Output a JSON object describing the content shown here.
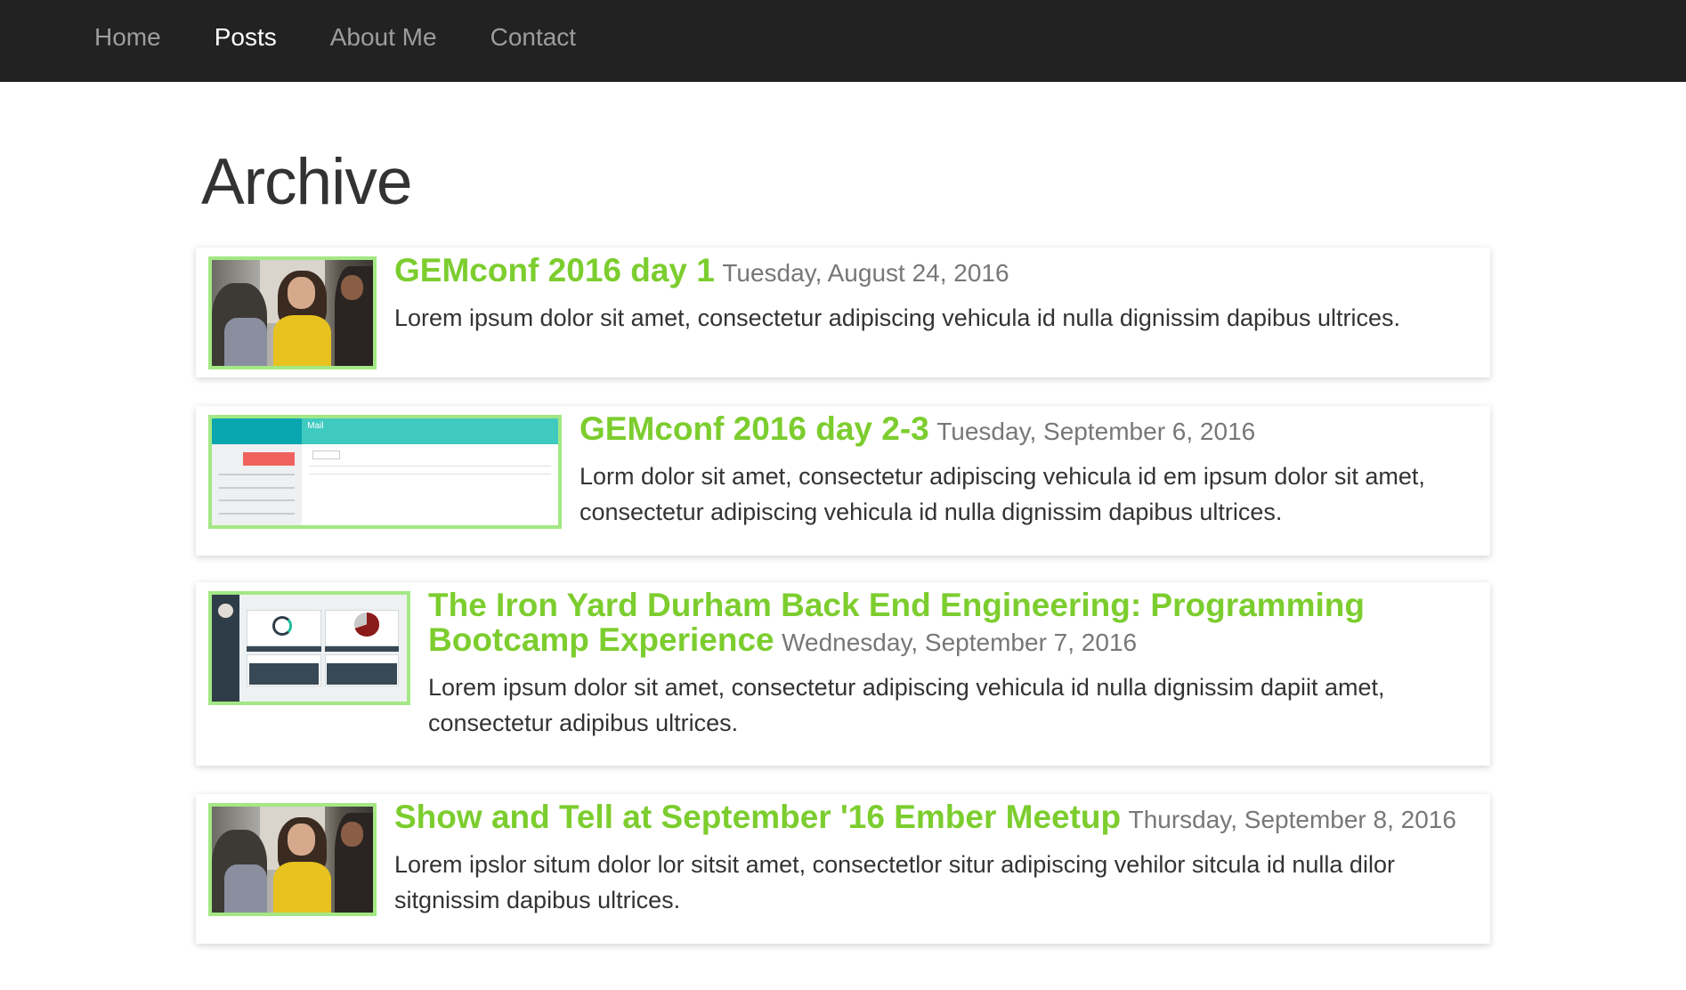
{
  "nav": {
    "items": [
      {
        "label": "Home",
        "active": false
      },
      {
        "label": "Posts",
        "active": true
      },
      {
        "label": "About Me",
        "active": false
      },
      {
        "label": "Contact",
        "active": false
      }
    ]
  },
  "page": {
    "title": "Archive"
  },
  "posts": [
    {
      "title": "GEMconf 2016 day 1",
      "date": "Tuesday, August 24, 2016",
      "excerpt": "Lorem ipsum dolor sit amet, consectetur adipiscing vehicula id nulla dignissim dapibus ultrices.",
      "thumbnail": "photo-conference-attendees"
    },
    {
      "title": "GEMconf 2016 day 2-3",
      "date": "Tuesday, September 6, 2016",
      "excerpt": "Lorm dolor sit amet, consectetur adipiscing vehicula id em ipsum dolor sit amet, consectetur adipiscing vehicula id nulla dignissim dapibus ultrices.",
      "thumbnail": "screenshot-mail-app",
      "thumb_text": "Mail"
    },
    {
      "title": "The Iron Yard Durham Back End Engineering: Programming Bootcamp Experience",
      "date": "Wednesday, September 7, 2016",
      "excerpt": "Lorem ipsum dolor sit amet, consectetur adipiscing vehicula id nulla dignissim dapiit amet, consectetur adipibus ultrices.",
      "thumbnail": "screenshot-dashboard"
    },
    {
      "title": "Show and Tell at September '16 Ember Meetup",
      "date": "Thursday, September 8, 2016",
      "excerpt": "Lorem ipslor situm dolor lor sitsit amet, consectetlor situr adipiscing vehilor sitcula id nulla dilor sitgnissim dapibus ultrices.",
      "thumbnail": "photo-conference-attendees"
    }
  ],
  "colors": {
    "navbar_bg": "#222222",
    "nav_text": "#9d9d9d",
    "nav_active": "#ffffff",
    "post_title": "#7ccd2e",
    "thumb_border": "#a3e884",
    "date_text": "#777777"
  }
}
